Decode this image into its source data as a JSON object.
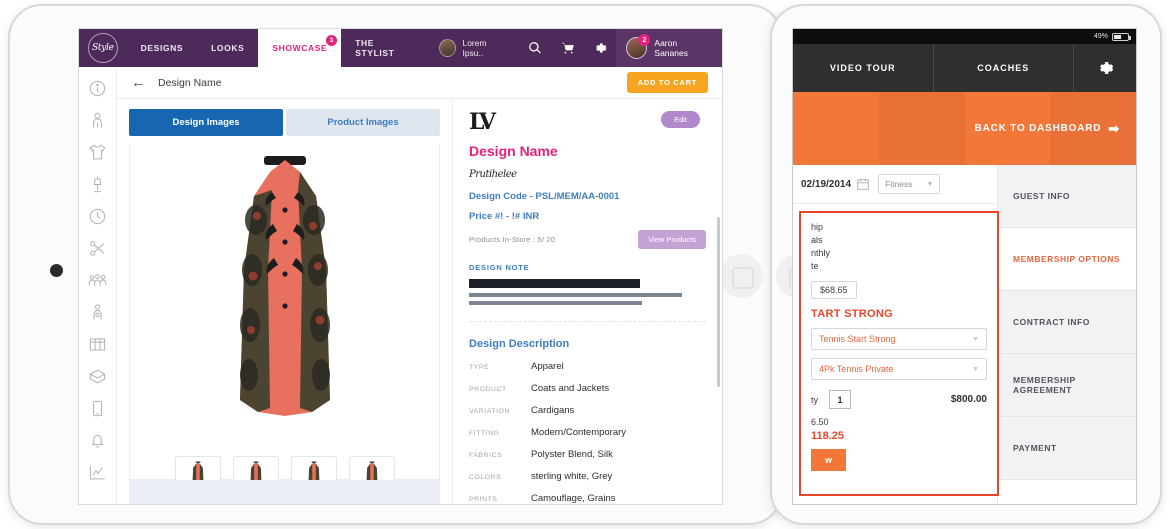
{
  "left_tablet": {
    "navbar": {
      "brand": "Style",
      "items": [
        {
          "label": "DESIGNS",
          "badge": null,
          "active": false
        },
        {
          "label": "LOOKS",
          "badge": null,
          "active": false
        },
        {
          "label": "SHOWCASE",
          "badge": "3",
          "active": true
        },
        {
          "label": "THE STYLIST",
          "badge": null,
          "active": false
        }
      ],
      "user_chip": "Lorem Ipsu..",
      "icons": [
        "search-icon",
        "cart-icon",
        "gear-icon"
      ],
      "account_name": "Aaron Sananes",
      "account_badge": "2"
    },
    "breadcrumb": {
      "back": "←",
      "title": "Design Name",
      "add_to_cart": "ADD TO CART"
    },
    "gallery": {
      "tabs": [
        {
          "label": "Design Images",
          "active": true
        },
        {
          "label": "Product Images",
          "active": false
        }
      ],
      "thumb_count": 4
    },
    "detail": {
      "logo": "LV",
      "edit_label": "Edit",
      "design_name": "Design Name",
      "signature": "Prutihelee",
      "design_code": "Design Code - PSL/MEM/AA-0001",
      "price": "Price  #! - !# INR",
      "in_store": "Products In-Store : 5/ 20",
      "view_products": "View Products",
      "design_note_label": "DESIGN NOTE",
      "design_description_title": "Design Description",
      "attributes": [
        {
          "key": "TYPE",
          "value": "Apparel"
        },
        {
          "key": "PRODUCT",
          "value": "Coats and Jackets"
        },
        {
          "key": "VARIATION",
          "value": "Cardigans"
        },
        {
          "key": "FITTING",
          "value": "Modern/Contemporary"
        },
        {
          "key": "FABRICS",
          "value": "Polyster Blend, Silk"
        },
        {
          "key": "COLORS",
          "value": "sterling white, Grey"
        },
        {
          "key": "PRINTS",
          "value": "Camouflage, Grains"
        }
      ]
    },
    "rail_icons": [
      "info-icon",
      "person-icon",
      "tshirt-icon",
      "mannequin-icon",
      "clock-icon",
      "scissors-icon",
      "group-icon",
      "tailor-icon",
      "books-icon",
      "box-icon",
      "mobile-icon",
      "bell-icon",
      "chart-icon"
    ]
  },
  "right_tablet": {
    "status": {
      "battery_pct": "49%"
    },
    "tabs": [
      {
        "label": "VIDEO TOUR"
      },
      {
        "label": "COACHES"
      },
      {
        "label": "",
        "icon": "gear-icon"
      }
    ],
    "hero": {
      "cta": "BACK TO DASHBOARD",
      "arrow": "➡"
    },
    "form": {
      "date": "02/19/2014",
      "category": "Fitness",
      "lines": [
        "hip",
        "als",
        "nthly",
        "te"
      ],
      "amount": "$68.65",
      "promo_head": "TART STRONG",
      "select_1": "Tennis Start Strong",
      "select_2": "4Pk Tennis Private",
      "qty_label": "ty",
      "qty_value": "1",
      "qty_price": "$800.00",
      "sub_value": "6.50",
      "total_value": "118.25",
      "action_label": "w"
    },
    "side_items": [
      {
        "label": "GUEST INFO",
        "active": false
      },
      {
        "label": "MEMBERSHIP OPTIONS",
        "active": true
      },
      {
        "label": "CONTRACT INFO",
        "active": false
      },
      {
        "label": "MEMBERSHIP AGREEMENT",
        "active": false
      },
      {
        "label": "PAYMENT",
        "active": false
      }
    ]
  }
}
